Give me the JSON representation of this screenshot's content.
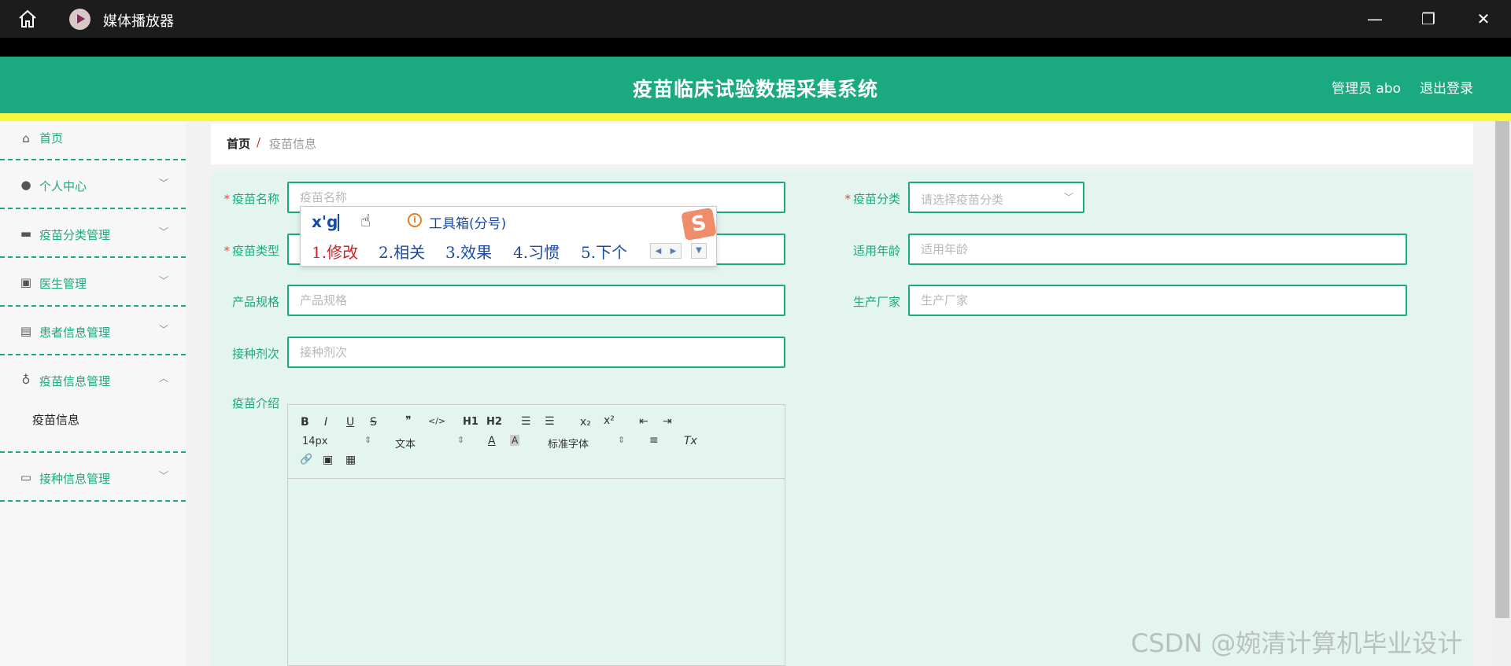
{
  "window": {
    "title": "媒体播放器",
    "controls": {
      "minimize": "—",
      "maximize": "❐",
      "close": "✕"
    }
  },
  "header": {
    "title": "疫苗临床试验数据采集系统",
    "user": "管理员 abo",
    "logout": "退出登录",
    "color": "#1ba97f"
  },
  "sidebar": {
    "items": [
      {
        "label": "首页",
        "icon": "home-icon"
      },
      {
        "label": "个人中心",
        "icon": "user-icon"
      },
      {
        "label": "疫苗分类管理",
        "icon": "chat-icon"
      },
      {
        "label": "医生管理",
        "icon": "briefcase-icon"
      },
      {
        "label": "患者信息管理",
        "icon": "clipboard-icon"
      },
      {
        "label": "疫苗信息管理",
        "icon": "microphone-icon"
      },
      {
        "label": "接种信息管理",
        "icon": "monitor-icon"
      }
    ],
    "active_sub": "疫苗信息"
  },
  "breadcrumb": {
    "home": "首页",
    "separator": "/",
    "current": "疫苗信息"
  },
  "form": {
    "vaccine_name": {
      "label": "疫苗名称",
      "placeholder": "疫苗名称"
    },
    "vaccine_category": {
      "label": "疫苗分类",
      "placeholder": "请选择疫苗分类"
    },
    "vaccine_type": {
      "label": "疫苗类型"
    },
    "applicable_age": {
      "label": "适用年龄",
      "placeholder": "适用年龄"
    },
    "product_spec": {
      "label": "产品规格",
      "placeholder": "产品规格"
    },
    "manufacturer": {
      "label": "生产厂家",
      "placeholder": "生产厂家"
    },
    "dose": {
      "label": "接种剂次",
      "placeholder": "接种剂次"
    },
    "intro": {
      "label": "疫苗介绍"
    }
  },
  "editor": {
    "bold": "B",
    "italic": "I",
    "underline": "U",
    "strike": "S",
    "quote": "❞",
    "code": "</>",
    "h1": "H1",
    "h2": "H2",
    "ordered_list": "☰",
    "bullet_list": "☰",
    "sub": "x₂",
    "sup": "x²",
    "outdent": "⇤",
    "indent": "⇥",
    "font_size": "14px",
    "header_select": "文本",
    "font_family": "标准字体",
    "align": "≡",
    "clean": "Tx",
    "link": "🔗",
    "image": "▣",
    "video": "▦"
  },
  "ime": {
    "input": "x'g",
    "toolbox": "工具箱(分号)",
    "candidates": [
      "1.修改",
      "2.相关",
      "3.效果",
      "4.习惯",
      "5.下个"
    ],
    "logo": "S"
  },
  "watermark": "CSDN @婉清计算机毕业设计"
}
